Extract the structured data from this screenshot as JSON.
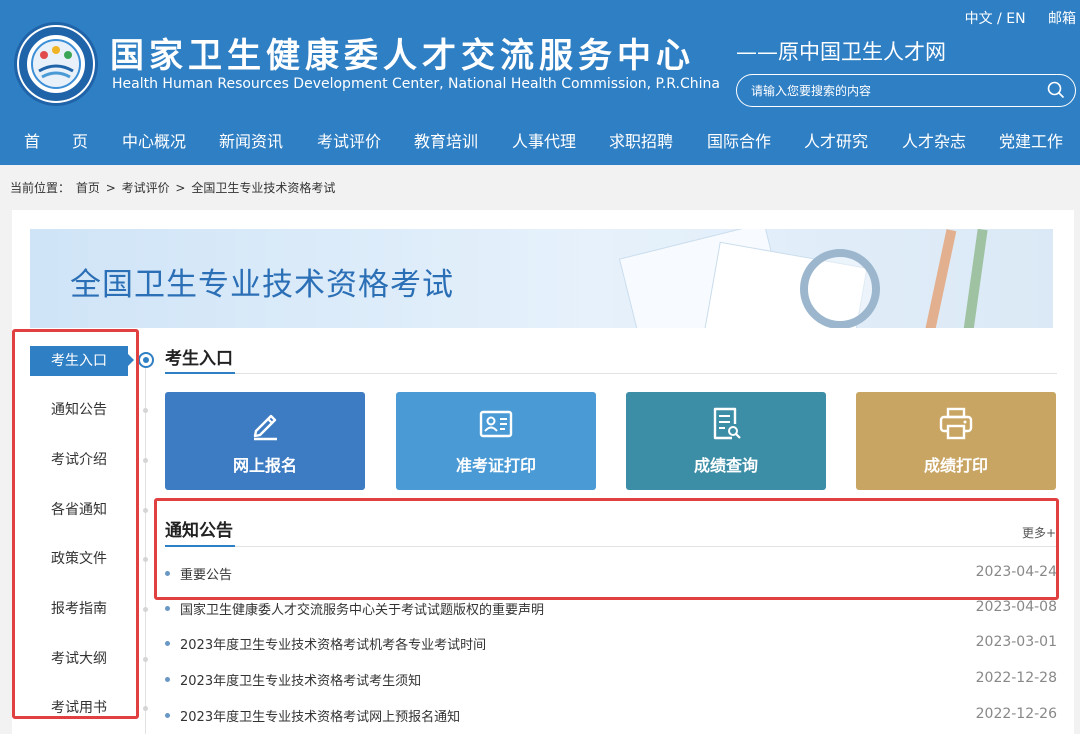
{
  "header": {
    "title": "国家卫生健康委人才交流服务中心",
    "subtitle": "Health Human Resources Development Center, National Health Commission, P.R.China",
    "slogan": "——原中国卫生人才网",
    "language_switch": "中文 / EN",
    "mail_link": "邮箱",
    "search": {
      "placeholder": "请输入您要搜索的内容",
      "icon": "search-icon"
    },
    "brand_color": "#2f7fc4"
  },
  "nav": {
    "items": [
      {
        "label": "首　　页"
      },
      {
        "label": "中心概况"
      },
      {
        "label": "新闻资讯"
      },
      {
        "label": "考试评价"
      },
      {
        "label": "教育培训"
      },
      {
        "label": "人事代理"
      },
      {
        "label": "求职招聘"
      },
      {
        "label": "国际合作"
      },
      {
        "label": "人才研究"
      },
      {
        "label": "人才杂志"
      },
      {
        "label": "党建工作"
      }
    ]
  },
  "breadcrumb": {
    "prefix": "当前位置：",
    "items": [
      "首页",
      "考试评价",
      "全国卫生专业技术资格考试"
    ],
    "separator": ">"
  },
  "banner": {
    "title": "全国卫生专业技术资格考试"
  },
  "sidebar": {
    "items": [
      {
        "label": "考生入口",
        "active": true
      },
      {
        "label": "通知公告"
      },
      {
        "label": "考试介绍"
      },
      {
        "label": "各省通知"
      },
      {
        "label": "政策文件"
      },
      {
        "label": "报考指南"
      },
      {
        "label": "考试大纲"
      },
      {
        "label": "考试用书"
      }
    ]
  },
  "entry_section": {
    "title": "考生入口",
    "tiles": [
      {
        "label": "网上报名",
        "icon": "pencil-icon",
        "color": "#3d7cc3"
      },
      {
        "label": "准考证打印",
        "icon": "id-card-icon",
        "color": "#4a9ad6"
      },
      {
        "label": "成绩查询",
        "icon": "document-search-icon",
        "color": "#3c8ea6"
      },
      {
        "label": "成绩打印",
        "icon": "printer-icon",
        "color": "#c9a563"
      }
    ]
  },
  "notice_section": {
    "title": "通知公告",
    "more": "更多+",
    "items": [
      {
        "title": "重要公告",
        "date": "2023-04-24"
      },
      {
        "title": "国家卫生健康委人才交流服务中心关于考试试题版权的重要声明",
        "date": "2023-04-08"
      },
      {
        "title": "2023年度卫生专业技术资格考试机考各专业考试时间",
        "date": "2023-03-01"
      },
      {
        "title": "2023年度卫生专业技术资格考试考生须知",
        "date": "2022-12-28"
      },
      {
        "title": "2023年度卫生专业技术资格考试网上预报名通知",
        "date": "2022-12-26"
      }
    ]
  },
  "highlight_color": "#e04040"
}
